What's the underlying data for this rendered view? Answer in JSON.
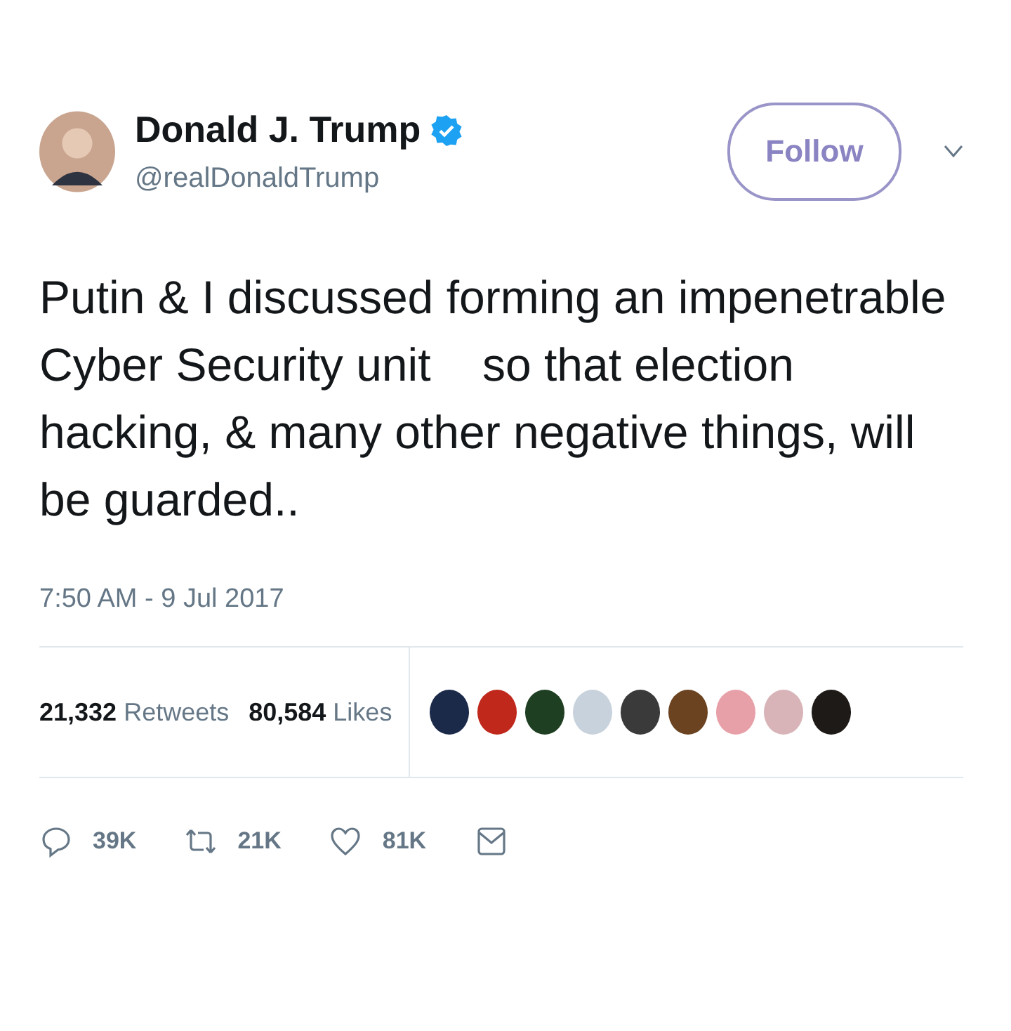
{
  "author": {
    "name": "Donald J. Trump",
    "verified": true,
    "handle": "@realDonaldTrump"
  },
  "follow_button": "Follow",
  "text": "Putin & I discussed forming an impenetrable Cyber Security unit    so that election hacking, & many other negative things, will be guarded..",
  "timestamp": "7:50 AM - 9 Jul 2017",
  "stats": [
    {
      "count": "21,332",
      "label": "Retweets"
    },
    {
      "count": "80,584",
      "label": "Likes"
    }
  ],
  "likers": [
    {
      "color": "#1c2a4a"
    },
    {
      "color": "#c0281c"
    },
    {
      "color": "#1f3f22"
    },
    {
      "color": "#c8d2dc"
    },
    {
      "color": "#3a3a3a"
    },
    {
      "color": "#6b4320"
    },
    {
      "color": "#e8a0a8"
    },
    {
      "color": "#d8b4b8"
    },
    {
      "color": "#1e1a18"
    }
  ],
  "actions": [
    {
      "kind": "reply",
      "count": "39K"
    },
    {
      "kind": "retweet",
      "count": "21K"
    },
    {
      "kind": "like",
      "count": "81K"
    },
    {
      "kind": "message"
    }
  ]
}
